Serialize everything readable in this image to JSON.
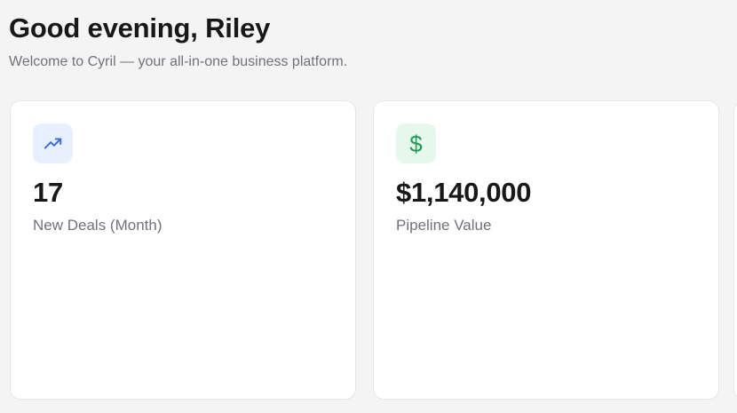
{
  "header": {
    "greeting": "Good evening, Riley",
    "subtitle": "Welcome to Cyril — your all-in-one business platform."
  },
  "stats": [
    {
      "value": "17",
      "label": "New Deals (Month)",
      "icon": "trending-up-icon",
      "accent": "#3b6fd9",
      "tile_bg": "#e8efff"
    },
    {
      "value": "$1,140,000",
      "label": "Pipeline Value",
      "icon": "dollar-sign-icon",
      "icon_glyph": "$",
      "accent": "#1f9d55",
      "tile_bg": "#e6f8ec"
    }
  ],
  "colors": {
    "background": "#f4f4f5",
    "card": "#ffffff",
    "text_primary": "#18181b",
    "text_secondary": "#71717a"
  }
}
